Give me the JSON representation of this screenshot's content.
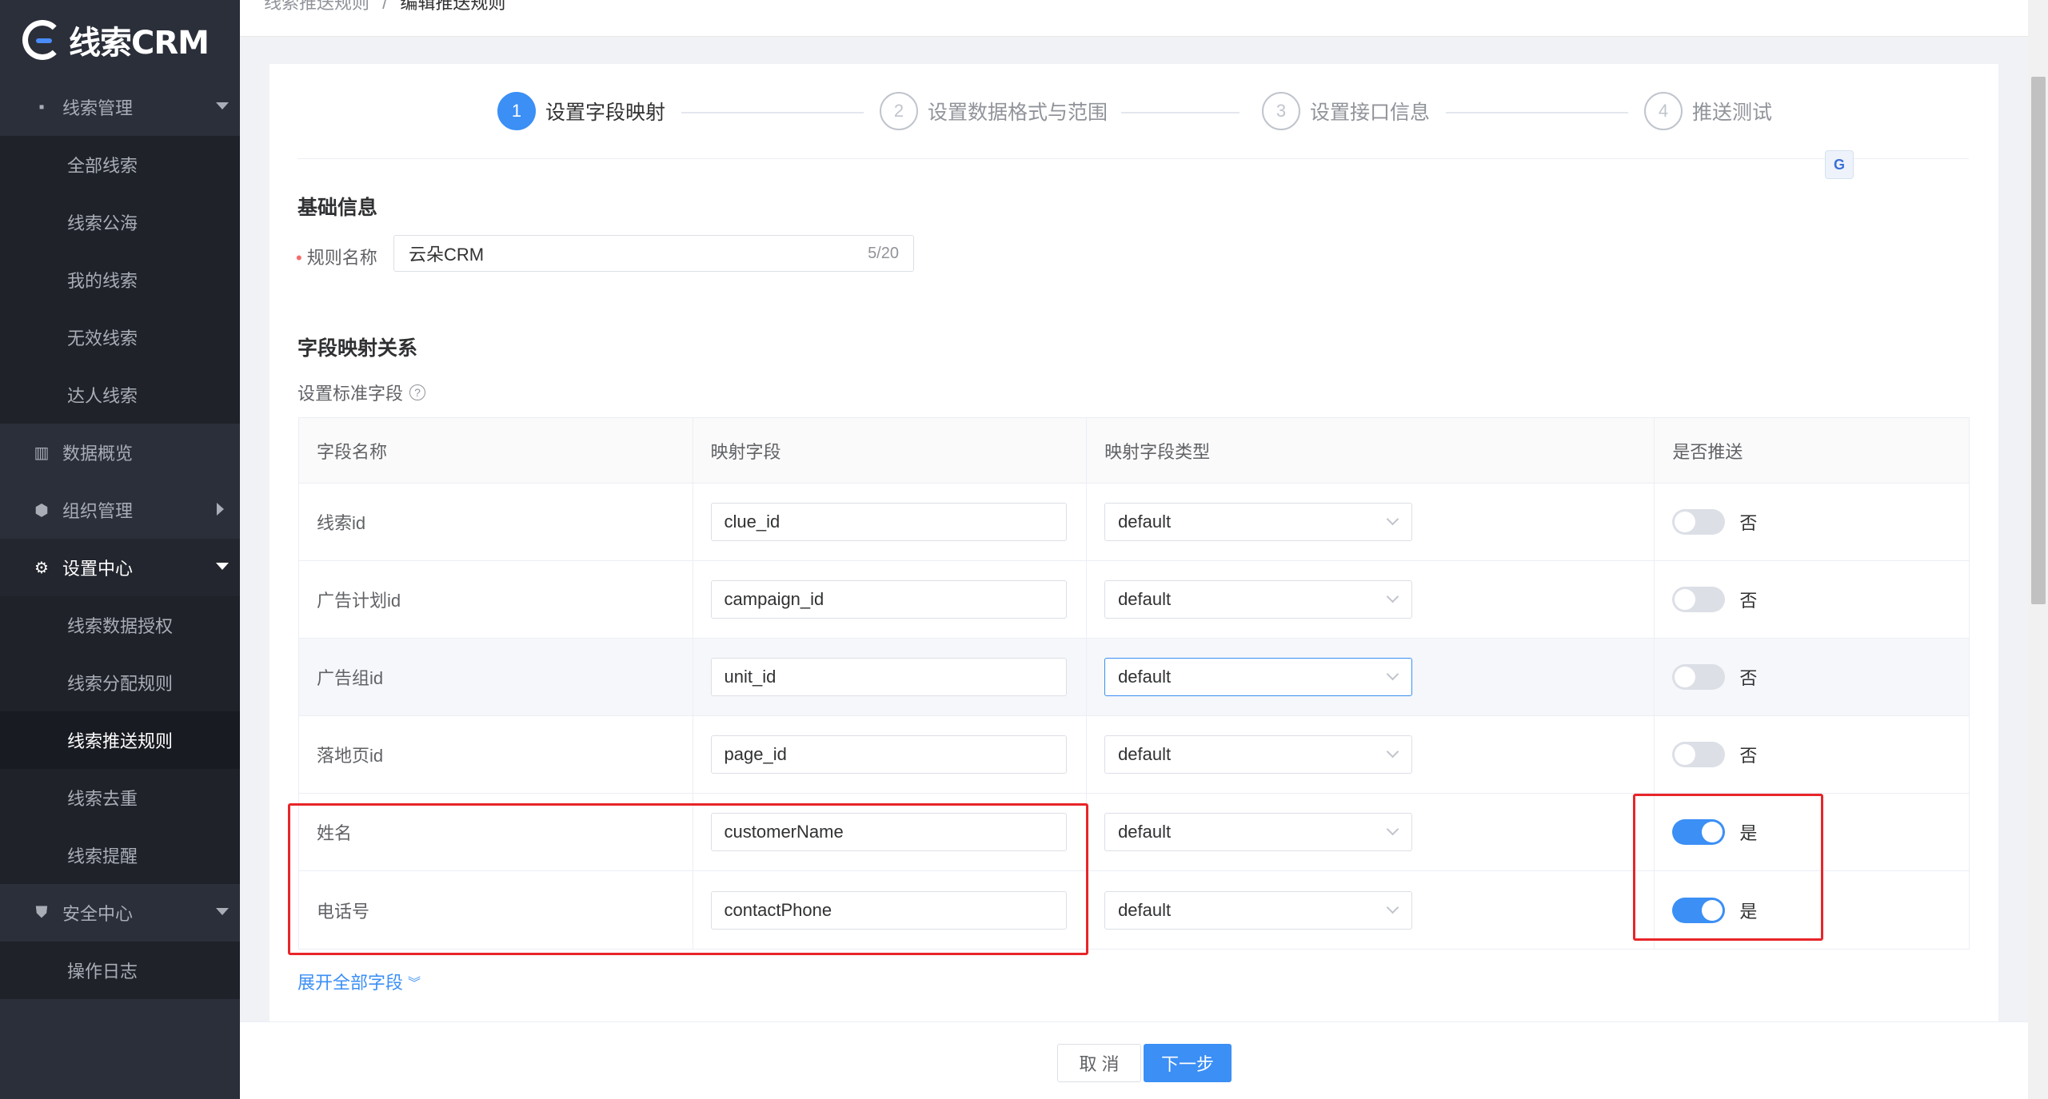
{
  "app": {
    "logo_text": "线索CRM"
  },
  "breadcrumb": {
    "parent": "线索推送规则",
    "separator": "/",
    "current": "编辑推送规则"
  },
  "sidebar": {
    "items": [
      {
        "label": "线索管理",
        "icon": "file-icon",
        "level": "parent",
        "arrow": "down"
      },
      {
        "label": "全部线索",
        "level": "child"
      },
      {
        "label": "线索公海",
        "level": "child"
      },
      {
        "label": "我的线索",
        "level": "child"
      },
      {
        "label": "无效线索",
        "level": "child"
      },
      {
        "label": "达人线索",
        "level": "child"
      },
      {
        "label": "数据概览",
        "icon": "chart-icon",
        "level": "parent"
      },
      {
        "label": "组织管理",
        "icon": "cube-icon",
        "level": "parent",
        "arrow": "right"
      },
      {
        "label": "设置中心",
        "icon": "gear-icon",
        "level": "parent",
        "arrow": "down",
        "active": true
      },
      {
        "label": "线索数据授权",
        "level": "child"
      },
      {
        "label": "线索分配规则",
        "level": "child"
      },
      {
        "label": "线索推送规则",
        "level": "child",
        "selected": true
      },
      {
        "label": "线索去重",
        "level": "child"
      },
      {
        "label": "线索提醒",
        "level": "child"
      },
      {
        "label": "安全中心",
        "icon": "shield-icon",
        "level": "parent",
        "arrow": "down"
      },
      {
        "label": "操作日志",
        "level": "child"
      }
    ]
  },
  "steps": [
    {
      "num": "1",
      "label": "设置字段映射",
      "active": true
    },
    {
      "num": "2",
      "label": "设置数据格式与范围"
    },
    {
      "num": "3",
      "label": "设置接口信息"
    },
    {
      "num": "4",
      "label": "推送测试"
    }
  ],
  "basic_info": {
    "title": "基础信息",
    "rule_name_label": "规则名称",
    "required_mark": "•",
    "rule_name_value": "云朵CRM",
    "rule_name_count": "5/20"
  },
  "mapping": {
    "title": "字段映射关系",
    "sub_label": "设置标准字段",
    "help_icon": "question-circle-icon",
    "columns": [
      "字段名称",
      "映射字段",
      "映射字段类型",
      "是否推送"
    ],
    "rows": [
      {
        "name": "线索id",
        "field": "clue_id",
        "type": "default",
        "push": false,
        "push_text": "否"
      },
      {
        "name": "广告计划id",
        "field": "campaign_id",
        "type": "default",
        "push": false,
        "push_text": "否"
      },
      {
        "name": "广告组id",
        "field": "unit_id",
        "type": "default",
        "push": false,
        "push_text": "否"
      },
      {
        "name": "落地页id",
        "field": "page_id",
        "type": "default",
        "push": false,
        "push_text": "否"
      },
      {
        "name": "姓名",
        "field": "customerName",
        "type": "default",
        "push": true,
        "push_text": "是"
      },
      {
        "name": "电话号",
        "field": "contactPhone",
        "type": "default",
        "push": true,
        "push_text": "是"
      }
    ],
    "expand_label": "展开全部字段",
    "expand_icon": "double-chevron-down-icon"
  },
  "footer": {
    "cancel_label": "取 消",
    "next_label": "下一步"
  },
  "colors": {
    "primary": "#3b8ff5",
    "sidebar_bg": "#2b2f3a",
    "highlight": "#e8252a"
  }
}
